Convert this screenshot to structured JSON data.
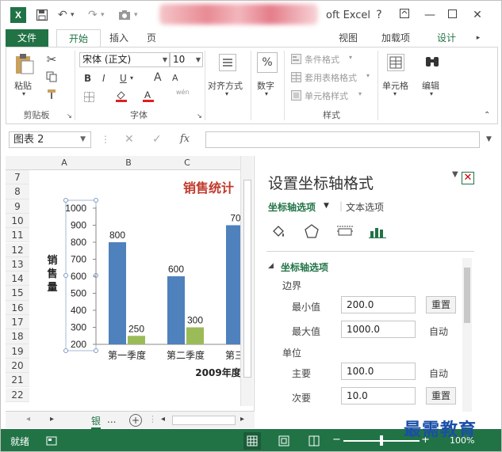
{
  "window": {
    "title_suffix": "oft Excel",
    "help": "?",
    "controls": [
      "?",
      "□",
      "—",
      "□",
      "✕"
    ]
  },
  "ribbon_tabs": [
    {
      "label": "文件"
    },
    {
      "label": "开始"
    },
    {
      "label": "插入"
    },
    {
      "label": "页"
    },
    {
      "label": "视图"
    },
    {
      "label": "加载项"
    },
    {
      "label": "设计"
    }
  ],
  "ribbon": {
    "clipboard": {
      "paste": "粘贴",
      "group": "剪贴板"
    },
    "font": {
      "name": "宋体 (正文)",
      "size": "10",
      "bold": "B",
      "italic": "I",
      "underline": "U",
      "grow": "A",
      "shrink": "A",
      "wen": "wén",
      "group": "字体"
    },
    "alignment": {
      "label": "对齐方式"
    },
    "number": {
      "label": "数字",
      "symbol": "%"
    },
    "styles": {
      "conditional": "条件格式",
      "table": "套用表格格式",
      "cell": "单元格样式",
      "group": "样式"
    },
    "cells": {
      "label": "单元格"
    },
    "editing": {
      "label": "编辑"
    }
  },
  "formula_bar": {
    "name_box": "图表 2",
    "fx": "fx"
  },
  "sheet": {
    "columns": [
      "A",
      "B",
      "C"
    ],
    "rows": [
      "7",
      "8",
      "9",
      "10",
      "11",
      "12",
      "13",
      "14",
      "15",
      "16",
      "17",
      "18",
      "19",
      "20",
      "21",
      "22"
    ]
  },
  "chart_data": {
    "type": "bar",
    "title": "销售统计",
    "ylabel": "销售量",
    "xlabel": "2009年度",
    "categories": [
      "第一季度",
      "第二季度",
      "第三季度"
    ],
    "series": [
      {
        "values": [
          800,
          600,
          900
        ],
        "color": "#4f81bd"
      },
      {
        "values": [
          250,
          300,
          null
        ],
        "color": "#9bbb59"
      }
    ],
    "data_labels": [
      "800",
      "250",
      "600",
      "300",
      "70"
    ],
    "yticks": [
      "1000",
      "900",
      "800",
      "700",
      "600",
      "500",
      "400",
      "300",
      "200"
    ],
    "ylim": [
      200,
      1000
    ]
  },
  "pane": {
    "title": "设置坐标轴格式",
    "tab_axis": "坐标轴选项",
    "tab_text": "文本选项",
    "section": "坐标轴选项",
    "bounds_label": "边界",
    "min_label": "最小值",
    "min_value": "200.0",
    "min_action": "重置",
    "max_label": "最大值",
    "max_value": "1000.0",
    "max_action": "自动",
    "units_label": "单位",
    "major_label": "主要",
    "major_value": "100.0",
    "major_action": "自动",
    "minor_label": "次要",
    "minor_value": "10.0",
    "minor_action": "重置"
  },
  "sheet_tabs": {
    "tab": "银",
    "more": "..."
  },
  "status": {
    "text": "就绪",
    "zoom": "100%"
  },
  "watermark": "最需教育",
  "colors": {
    "excel_green": "#217346",
    "bar_blue": "#4f81bd",
    "bar_green": "#9bbb59",
    "title_red": "#c0392b"
  }
}
